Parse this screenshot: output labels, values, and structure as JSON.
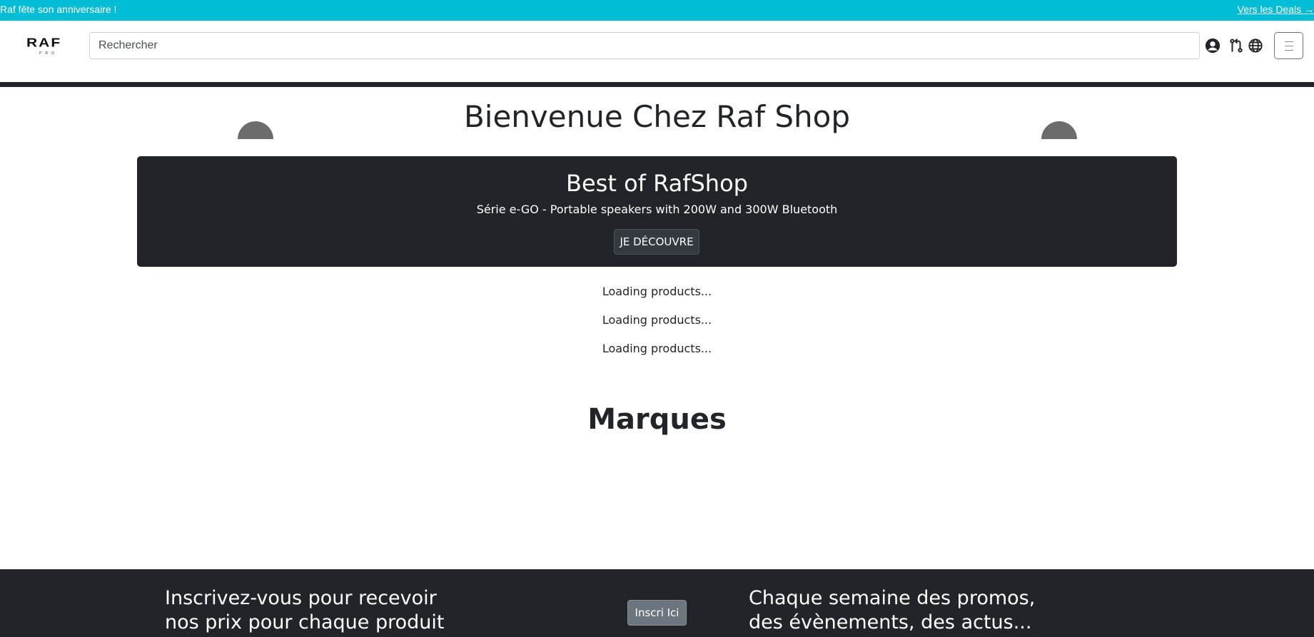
{
  "promo_bar": {
    "text": "Raf fête son anniversaire !",
    "link_label": "Vers les Deals →",
    "background": "#00bcd4"
  },
  "header": {
    "logo": {
      "main": "RAF",
      "sub": "PRO"
    },
    "search": {
      "placeholder": "Rechercher",
      "value": ""
    },
    "icons": [
      "user-circle-icon",
      "compare-arrows-icon",
      "globe-icon",
      "hamburger-menu-icon"
    ]
  },
  "main": {
    "welcome_title": "Bienvenue Chez Raf Shop",
    "carousel_controls": [
      "carousel-prev-button",
      "carousel-next-button"
    ],
    "hero": {
      "title": "Best of RafShop",
      "subtitle": "Série e-GO - Portable speakers with 200W and 300W Bluetooth",
      "button_label": "JE DÉCOUVRE",
      "background": "#212529"
    },
    "loading_messages": [
      "Loading products...",
      "Loading products...",
      "Loading products..."
    ],
    "brands_title": "Marques"
  },
  "footer": {
    "left_text": "Inscrivez-vous pour recevoir nos prix pour chaque produit",
    "button_label": "Inscri Ici",
    "right_text": "Chaque semaine des promos, des évènements, des actus...",
    "background": "#212529"
  }
}
